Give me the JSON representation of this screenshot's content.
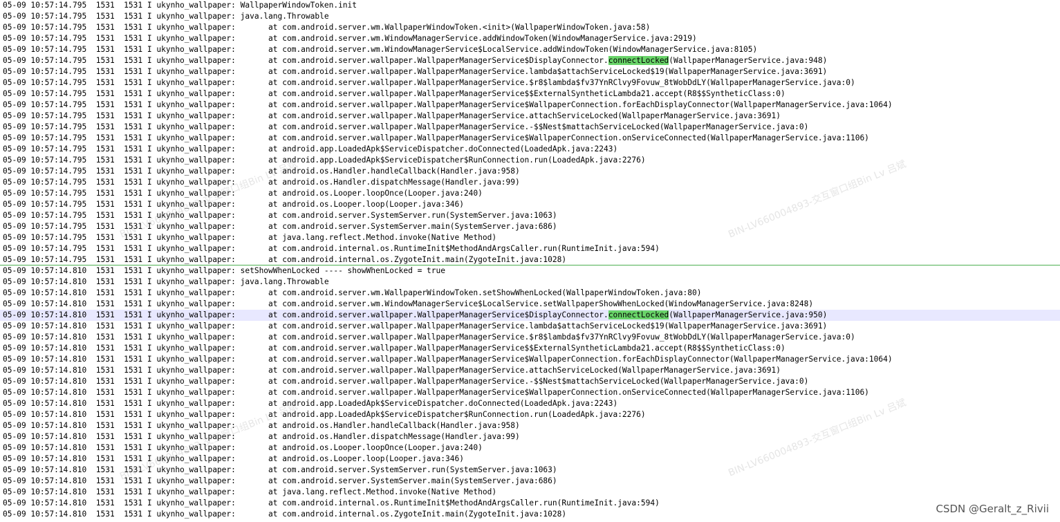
{
  "watermark_text": "BIN-LV660004893-交互窗口组Bin Lv 吕斌",
  "credit": "CSDN @Geralt_z_Rivii",
  "highlight_term": "connectLocked",
  "lines": [
    {
      "ts": "05-09 10:57:14.795",
      "pid": "1531",
      "tid": "1531",
      "lvl": "I",
      "tag": "ukynho_wallpaper:",
      "msg": " WallpaperWindowToken.init"
    },
    {
      "ts": "05-09 10:57:14.795",
      "pid": "1531",
      "tid": "1531",
      "lvl": "I",
      "tag": "ukynho_wallpaper:",
      "msg": " java.lang.Throwable"
    },
    {
      "ts": "05-09 10:57:14.795",
      "pid": "1531",
      "tid": "1531",
      "lvl": "I",
      "tag": "ukynho_wallpaper:",
      "msg": "       at com.android.server.wm.WallpaperWindowToken.<init>(WallpaperWindowToken.java:58)"
    },
    {
      "ts": "05-09 10:57:14.795",
      "pid": "1531",
      "tid": "1531",
      "lvl": "I",
      "tag": "ukynho_wallpaper:",
      "msg": "       at com.android.server.wm.WindowManagerService.addWindowToken(WindowManagerService.java:2919)"
    },
    {
      "ts": "05-09 10:57:14.795",
      "pid": "1531",
      "tid": "1531",
      "lvl": "I",
      "tag": "ukynho_wallpaper:",
      "msg": "       at com.android.server.wm.WindowManagerService$LocalService.addWindowToken(WindowManagerService.java:8105)"
    },
    {
      "ts": "05-09 10:57:14.795",
      "pid": "1531",
      "tid": "1531",
      "lvl": "I",
      "tag": "ukynho_wallpaper:",
      "msg": "       at com.android.server.wallpaper.WallpaperManagerService$DisplayConnector.connectLocked(WallpaperManagerService.java:948)"
    },
    {
      "ts": "05-09 10:57:14.795",
      "pid": "1531",
      "tid": "1531",
      "lvl": "I",
      "tag": "ukynho_wallpaper:",
      "msg": "       at com.android.server.wallpaper.WallpaperManagerService.lambda$attachServiceLocked$19(WallpaperManagerService.java:3691)"
    },
    {
      "ts": "05-09 10:57:14.795",
      "pid": "1531",
      "tid": "1531",
      "lvl": "I",
      "tag": "ukynho_wallpaper:",
      "msg": "       at com.android.server.wallpaper.WallpaperManagerService.$r8$lambda$fv37YnRClvy9Fovuw_8tWobDdLY(WallpaperManagerService.java:0)"
    },
    {
      "ts": "05-09 10:57:14.795",
      "pid": "1531",
      "tid": "1531",
      "lvl": "I",
      "tag": "ukynho_wallpaper:",
      "msg": "       at com.android.server.wallpaper.WallpaperManagerService$$ExternalSyntheticLambda21.accept(R8$$SyntheticClass:0)"
    },
    {
      "ts": "05-09 10:57:14.795",
      "pid": "1531",
      "tid": "1531",
      "lvl": "I",
      "tag": "ukynho_wallpaper:",
      "msg": "       at com.android.server.wallpaper.WallpaperManagerService$WallpaperConnection.forEachDisplayConnector(WallpaperManagerService.java:1064)"
    },
    {
      "ts": "05-09 10:57:14.795",
      "pid": "1531",
      "tid": "1531",
      "lvl": "I",
      "tag": "ukynho_wallpaper:",
      "msg": "       at com.android.server.wallpaper.WallpaperManagerService.attachServiceLocked(WallpaperManagerService.java:3691)"
    },
    {
      "ts": "05-09 10:57:14.795",
      "pid": "1531",
      "tid": "1531",
      "lvl": "I",
      "tag": "ukynho_wallpaper:",
      "msg": "       at com.android.server.wallpaper.WallpaperManagerService.-$$Nest$mattachServiceLocked(WallpaperManagerService.java:0)"
    },
    {
      "ts": "05-09 10:57:14.795",
      "pid": "1531",
      "tid": "1531",
      "lvl": "I",
      "tag": "ukynho_wallpaper:",
      "msg": "       at com.android.server.wallpaper.WallpaperManagerService$WallpaperConnection.onServiceConnected(WallpaperManagerService.java:1106)"
    },
    {
      "ts": "05-09 10:57:14.795",
      "pid": "1531",
      "tid": "1531",
      "lvl": "I",
      "tag": "ukynho_wallpaper:",
      "msg": "       at android.app.LoadedApk$ServiceDispatcher.doConnected(LoadedApk.java:2243)"
    },
    {
      "ts": "05-09 10:57:14.795",
      "pid": "1531",
      "tid": "1531",
      "lvl": "I",
      "tag": "ukynho_wallpaper:",
      "msg": "       at android.app.LoadedApk$ServiceDispatcher$RunConnection.run(LoadedApk.java:2276)"
    },
    {
      "ts": "05-09 10:57:14.795",
      "pid": "1531",
      "tid": "1531",
      "lvl": "I",
      "tag": "ukynho_wallpaper:",
      "msg": "       at android.os.Handler.handleCallback(Handler.java:958)"
    },
    {
      "ts": "05-09 10:57:14.795",
      "pid": "1531",
      "tid": "1531",
      "lvl": "I",
      "tag": "ukynho_wallpaper:",
      "msg": "       at android.os.Handler.dispatchMessage(Handler.java:99)"
    },
    {
      "ts": "05-09 10:57:14.795",
      "pid": "1531",
      "tid": "1531",
      "lvl": "I",
      "tag": "ukynho_wallpaper:",
      "msg": "       at android.os.Looper.loopOnce(Looper.java:240)"
    },
    {
      "ts": "05-09 10:57:14.795",
      "pid": "1531",
      "tid": "1531",
      "lvl": "I",
      "tag": "ukynho_wallpaper:",
      "msg": "       at android.os.Looper.loop(Looper.java:346)"
    },
    {
      "ts": "05-09 10:57:14.795",
      "pid": "1531",
      "tid": "1531",
      "lvl": "I",
      "tag": "ukynho_wallpaper:",
      "msg": "       at com.android.server.SystemServer.run(SystemServer.java:1063)"
    },
    {
      "ts": "05-09 10:57:14.795",
      "pid": "1531",
      "tid": "1531",
      "lvl": "I",
      "tag": "ukynho_wallpaper:",
      "msg": "       at com.android.server.SystemServer.main(SystemServer.java:686)"
    },
    {
      "ts": "05-09 10:57:14.795",
      "pid": "1531",
      "tid": "1531",
      "lvl": "I",
      "tag": "ukynho_wallpaper:",
      "msg": "       at java.lang.reflect.Method.invoke(Native Method)"
    },
    {
      "ts": "05-09 10:57:14.795",
      "pid": "1531",
      "tid": "1531",
      "lvl": "I",
      "tag": "ukynho_wallpaper:",
      "msg": "       at com.android.internal.os.RuntimeInit$MethodAndArgsCaller.run(RuntimeInit.java:594)"
    },
    {
      "ts": "05-09 10:57:14.795",
      "pid": "1531",
      "tid": "1531",
      "lvl": "I",
      "tag": "ukynho_wallpaper:",
      "msg": "       at com.android.internal.os.ZygoteInit.main(ZygoteInit.java:1028)",
      "separator": true
    },
    {
      "ts": "05-09 10:57:14.810",
      "pid": "1531",
      "tid": "1531",
      "lvl": "I",
      "tag": "ukynho_wallpaper:",
      "msg": " setShowWhenLocked ---- showWhenLocked = true"
    },
    {
      "ts": "05-09 10:57:14.810",
      "pid": "1531",
      "tid": "1531",
      "lvl": "I",
      "tag": "ukynho_wallpaper:",
      "msg": " java.lang.Throwable"
    },
    {
      "ts": "05-09 10:57:14.810",
      "pid": "1531",
      "tid": "1531",
      "lvl": "I",
      "tag": "ukynho_wallpaper:",
      "msg": "       at com.android.server.wm.WallpaperWindowToken.setShowWhenLocked(WallpaperWindowToken.java:80)"
    },
    {
      "ts": "05-09 10:57:14.810",
      "pid": "1531",
      "tid": "1531",
      "lvl": "I",
      "tag": "ukynho_wallpaper:",
      "msg": "       at com.android.server.wm.WindowManagerService$LocalService.setWallpaperShowWhenLocked(WindowManagerService.java:8248)"
    },
    {
      "ts": "05-09 10:57:14.810",
      "pid": "1531",
      "tid": "1531",
      "lvl": "I",
      "tag": "ukynho_wallpaper:",
      "msg": "       at com.android.server.wallpaper.WallpaperManagerService$DisplayConnector.connectLocked(WallpaperManagerService.java:950)",
      "current": true
    },
    {
      "ts": "05-09 10:57:14.810",
      "pid": "1531",
      "tid": "1531",
      "lvl": "I",
      "tag": "ukynho_wallpaper:",
      "msg": "       at com.android.server.wallpaper.WallpaperManagerService.lambda$attachServiceLocked$19(WallpaperManagerService.java:3691)"
    },
    {
      "ts": "05-09 10:57:14.810",
      "pid": "1531",
      "tid": "1531",
      "lvl": "I",
      "tag": "ukynho_wallpaper:",
      "msg": "       at com.android.server.wallpaper.WallpaperManagerService.$r8$lambda$fv37YnRClvy9Fovuw_8tWobDdLY(WallpaperManagerService.java:0)"
    },
    {
      "ts": "05-09 10:57:14.810",
      "pid": "1531",
      "tid": "1531",
      "lvl": "I",
      "tag": "ukynho_wallpaper:",
      "msg": "       at com.android.server.wallpaper.WallpaperManagerService$$ExternalSyntheticLambda21.accept(R8$$SyntheticClass:0)"
    },
    {
      "ts": "05-09 10:57:14.810",
      "pid": "1531",
      "tid": "1531",
      "lvl": "I",
      "tag": "ukynho_wallpaper:",
      "msg": "       at com.android.server.wallpaper.WallpaperManagerService$WallpaperConnection.forEachDisplayConnector(WallpaperManagerService.java:1064)"
    },
    {
      "ts": "05-09 10:57:14.810",
      "pid": "1531",
      "tid": "1531",
      "lvl": "I",
      "tag": "ukynho_wallpaper:",
      "msg": "       at com.android.server.wallpaper.WallpaperManagerService.attachServiceLocked(WallpaperManagerService.java:3691)"
    },
    {
      "ts": "05-09 10:57:14.810",
      "pid": "1531",
      "tid": "1531",
      "lvl": "I",
      "tag": "ukynho_wallpaper:",
      "msg": "       at com.android.server.wallpaper.WallpaperManagerService.-$$Nest$mattachServiceLocked(WallpaperManagerService.java:0)"
    },
    {
      "ts": "05-09 10:57:14.810",
      "pid": "1531",
      "tid": "1531",
      "lvl": "I",
      "tag": "ukynho_wallpaper:",
      "msg": "       at com.android.server.wallpaper.WallpaperManagerService$WallpaperConnection.onServiceConnected(WallpaperManagerService.java:1106)"
    },
    {
      "ts": "05-09 10:57:14.810",
      "pid": "1531",
      "tid": "1531",
      "lvl": "I",
      "tag": "ukynho_wallpaper:",
      "msg": "       at android.app.LoadedApk$ServiceDispatcher.doConnected(LoadedApk.java:2243)"
    },
    {
      "ts": "05-09 10:57:14.810",
      "pid": "1531",
      "tid": "1531",
      "lvl": "I",
      "tag": "ukynho_wallpaper:",
      "msg": "       at android.app.LoadedApk$ServiceDispatcher$RunConnection.run(LoadedApk.java:2276)"
    },
    {
      "ts": "05-09 10:57:14.810",
      "pid": "1531",
      "tid": "1531",
      "lvl": "I",
      "tag": "ukynho_wallpaper:",
      "msg": "       at android.os.Handler.handleCallback(Handler.java:958)"
    },
    {
      "ts": "05-09 10:57:14.810",
      "pid": "1531",
      "tid": "1531",
      "lvl": "I",
      "tag": "ukynho_wallpaper:",
      "msg": "       at android.os.Handler.dispatchMessage(Handler.java:99)"
    },
    {
      "ts": "05-09 10:57:14.810",
      "pid": "1531",
      "tid": "1531",
      "lvl": "I",
      "tag": "ukynho_wallpaper:",
      "msg": "       at android.os.Looper.loopOnce(Looper.java:240)"
    },
    {
      "ts": "05-09 10:57:14.810",
      "pid": "1531",
      "tid": "1531",
      "lvl": "I",
      "tag": "ukynho_wallpaper:",
      "msg": "       at android.os.Looper.loop(Looper.java:346)"
    },
    {
      "ts": "05-09 10:57:14.810",
      "pid": "1531",
      "tid": "1531",
      "lvl": "I",
      "tag": "ukynho_wallpaper:",
      "msg": "       at com.android.server.SystemServer.run(SystemServer.java:1063)"
    },
    {
      "ts": "05-09 10:57:14.810",
      "pid": "1531",
      "tid": "1531",
      "lvl": "I",
      "tag": "ukynho_wallpaper:",
      "msg": "       at com.android.server.SystemServer.main(SystemServer.java:686)"
    },
    {
      "ts": "05-09 10:57:14.810",
      "pid": "1531",
      "tid": "1531",
      "lvl": "I",
      "tag": "ukynho_wallpaper:",
      "msg": "       at java.lang.reflect.Method.invoke(Native Method)"
    },
    {
      "ts": "05-09 10:57:14.810",
      "pid": "1531",
      "tid": "1531",
      "lvl": "I",
      "tag": "ukynho_wallpaper:",
      "msg": "       at com.android.internal.os.RuntimeInit$MethodAndArgsCaller.run(RuntimeInit.java:594)"
    },
    {
      "ts": "05-09 10:57:14.810",
      "pid": "1531",
      "tid": "1531",
      "lvl": "I",
      "tag": "ukynho_wallpaper:",
      "msg": "       at com.android.internal.os.ZygoteInit.main(ZygoteInit.java:1028)"
    }
  ]
}
